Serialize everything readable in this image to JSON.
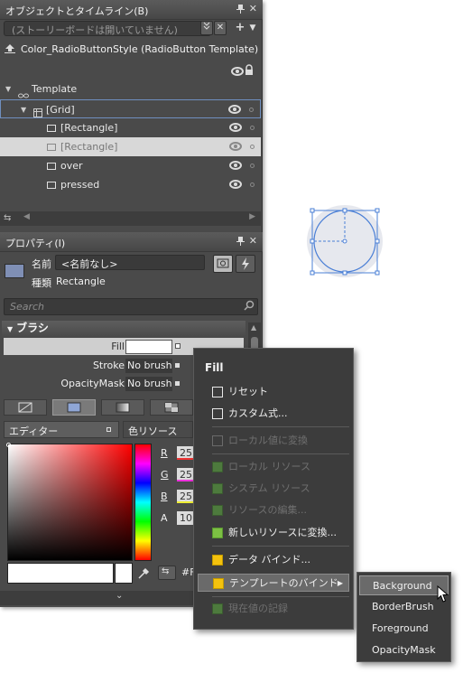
{
  "objects_panel": {
    "title": "オブジェクトとタイムライン(B)",
    "storyboard_placeholder": "(ストーリーボードは開いていません)",
    "style_name": "Color_RadioButtonStyle (RadioButton Template)",
    "tree": [
      {
        "label": "Template",
        "depth": 0
      },
      {
        "label": "[Grid]",
        "depth": 1
      },
      {
        "label": "[Rectangle]",
        "depth": 2
      },
      {
        "label": "[Rectangle]",
        "depth": 2,
        "selected": true
      },
      {
        "label": "over",
        "depth": 2
      },
      {
        "label": "pressed",
        "depth": 2
      }
    ]
  },
  "properties_panel": {
    "title": "プロパティ(I)",
    "name_label": "名前",
    "name_value": "<名前なし>",
    "type_label": "種類",
    "type_value": "Rectangle",
    "search_placeholder": "Search",
    "category": "ブラシ",
    "rows": [
      {
        "label": "Fill",
        "value": ""
      },
      {
        "label": "Stroke",
        "value": "No brush"
      },
      {
        "label": "OpacityMask",
        "value": "No brush"
      }
    ],
    "tabs": {
      "editor": "エディター",
      "resources": "色リソース"
    },
    "rgb": [
      {
        "label": "R",
        "value": "25"
      },
      {
        "label": "G",
        "value": "25"
      },
      {
        "label": "B",
        "value": "25"
      },
      {
        "label": "A",
        "value": "10"
      }
    ],
    "hex_value": "#F"
  },
  "context_menu": {
    "header": "Fill",
    "items": [
      {
        "label": "リセット",
        "enabled": true
      },
      {
        "label": "カスタム式...",
        "enabled": true
      },
      {
        "label": "ローカル値に変換",
        "enabled": false
      },
      {
        "label": "ローカル リソース",
        "enabled": false
      },
      {
        "label": "システム リソース",
        "enabled": false
      },
      {
        "label": "リソースの編集...",
        "enabled": false
      },
      {
        "label": "新しいリソースに変換...",
        "enabled": true
      },
      {
        "label": "データ バインド...",
        "enabled": true
      },
      {
        "label": "テンプレートのバインド",
        "enabled": true,
        "highlighted": true
      },
      {
        "label": "現在値の記録",
        "enabled": false
      }
    ]
  },
  "submenu": {
    "items": [
      "Background",
      "BorderBrush",
      "Foreground",
      "OpacityMask"
    ]
  }
}
